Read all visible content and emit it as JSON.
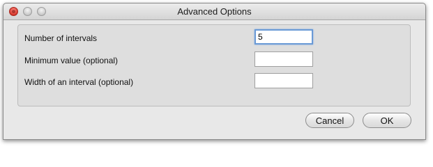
{
  "window": {
    "title": "Advanced Options"
  },
  "form": {
    "fields": [
      {
        "label": "Number of intervals",
        "value": "5",
        "focused": true
      },
      {
        "label": "Minimum value (optional)",
        "value": ""
      },
      {
        "label": "Width of an interval (optional)",
        "value": ""
      }
    ]
  },
  "buttons": {
    "cancel_label": "Cancel",
    "ok_label": "OK"
  },
  "colors": {
    "focus_ring": "#6a9ad6",
    "close_button": "#d6372b"
  },
  "icons": {
    "close": "close-icon",
    "minimize": "minimize-icon",
    "zoom": "zoom-icon"
  }
}
